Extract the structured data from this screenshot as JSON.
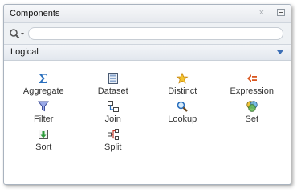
{
  "panel": {
    "title": "Components",
    "close_glyph": "×"
  },
  "search": {
    "value": "",
    "placeholder": ""
  },
  "category": {
    "selected": "Logical"
  },
  "components": [
    {
      "label": "Aggregate",
      "icon": "sigma-icon"
    },
    {
      "label": "Dataset",
      "icon": "dataset-icon"
    },
    {
      "label": "Distinct",
      "icon": "star-icon"
    },
    {
      "label": "Expression",
      "icon": "expression-icon"
    },
    {
      "label": "Filter",
      "icon": "funnel-icon"
    },
    {
      "label": "Join",
      "icon": "join-icon"
    },
    {
      "label": "Lookup",
      "icon": "magnifier-icon"
    },
    {
      "label": "Set",
      "icon": "venn-icon"
    },
    {
      "label": "Sort",
      "icon": "sort-icon"
    },
    {
      "label": "Split",
      "icon": "split-icon"
    }
  ],
  "colors": {
    "accent": "#3d6fb6",
    "border": "#a9b3bf"
  }
}
